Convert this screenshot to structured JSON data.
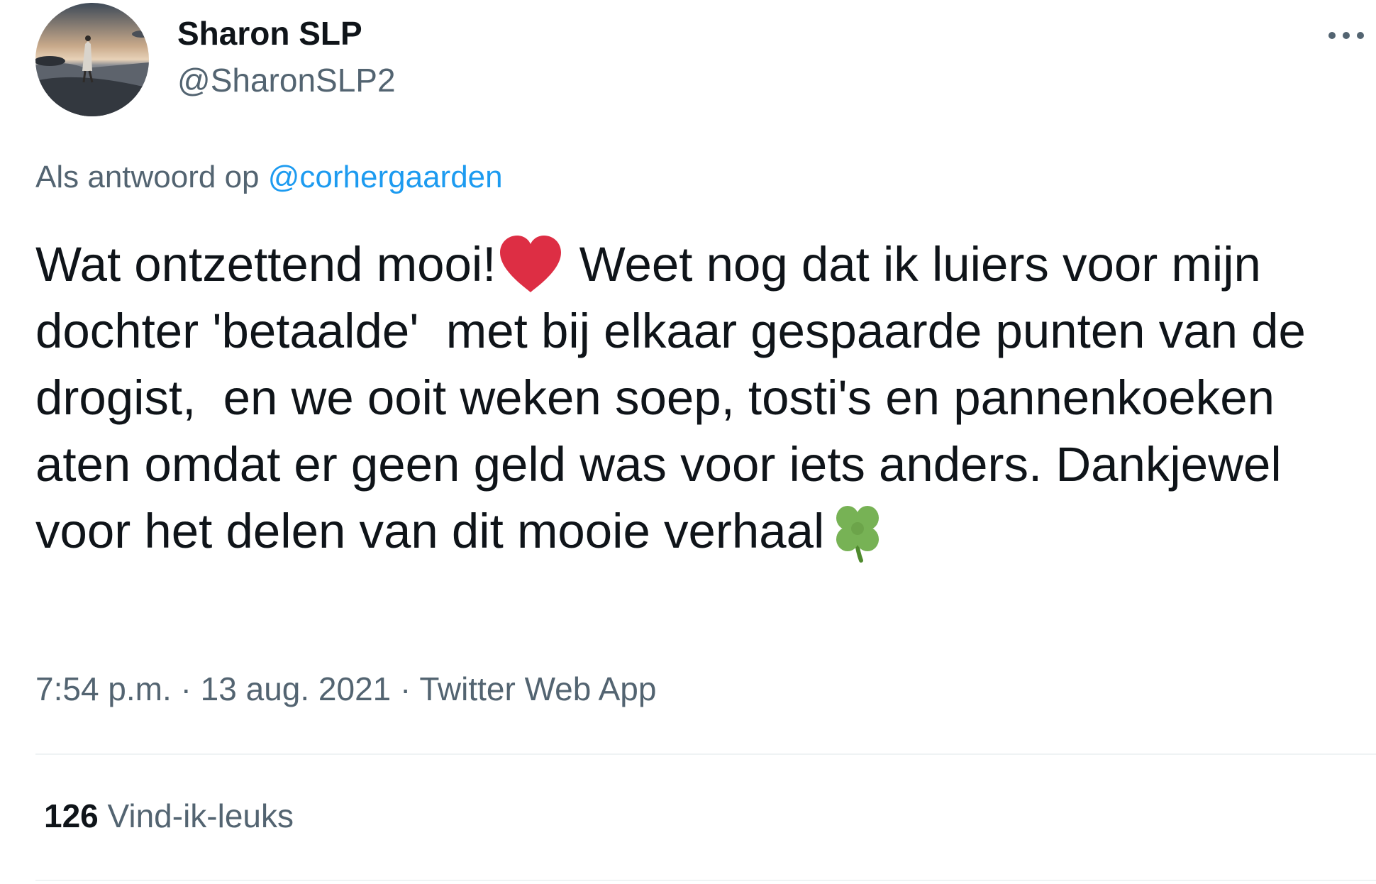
{
  "author": {
    "display_name": "Sharon SLP",
    "handle": "@SharonSLP2"
  },
  "reply_context": {
    "prefix": "Als antwoord op",
    "mention": "@corhergaarden"
  },
  "tweet": {
    "text_part1": "Wat ontzettend mooi!",
    "heart_emoji": "heart-emoji",
    "text_part2": " Weet nog dat ik luiers voor mijn dochter 'betaalde'  met bij elkaar gespaarde punten van de drogist,  en we ooit weken soep, tosti's en pannenkoeken aten omdat er geen geld was voor iets anders. Dankjewel voor het delen van dit mooie verhaal",
    "clover_emoji": "four-leaf-clover-emoji"
  },
  "meta": {
    "time": "7:54 p.m.",
    "separator": "·",
    "date": "13 aug. 2021",
    "source": "Twitter Web App"
  },
  "stats": {
    "likes_count": "126",
    "likes_label": "Vind-ik-leuks"
  },
  "colors": {
    "text_primary": "#0f1419",
    "text_secondary": "#536471",
    "link": "#1d9bf0",
    "divider": "#eff3f4",
    "heart": "#dd2e44",
    "clover": "#77b255"
  }
}
